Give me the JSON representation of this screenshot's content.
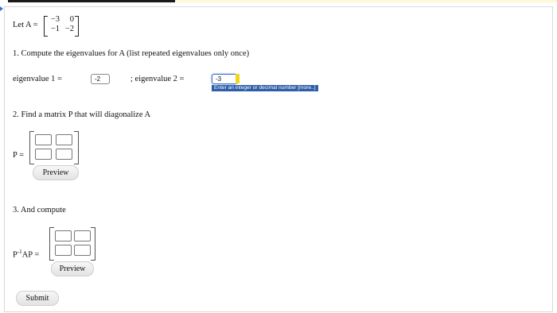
{
  "intro": {
    "let_label": "Let A =",
    "matrix": [
      [
        "−3",
        "0"
      ],
      [
        "−1",
        "−2"
      ]
    ]
  },
  "q1": {
    "prompt": "1. Compute the eigenvalues for A (list repeated eigenvalues only once)",
    "eig1_label": "eigenvalue 1 =",
    "eig1_value": "-2",
    "eig2_label": "; eigenvalue 2 =",
    "eig2_value": "-3",
    "hint": "Enter an integer or decimal number [more..]"
  },
  "q2": {
    "prompt": "2. Find a matrix P that will diagonalize A",
    "matrix_label": "P =",
    "preview_label": "Preview"
  },
  "q3": {
    "prompt": "3. And compute",
    "matrix_label_prefix": "P",
    "matrix_label_sup": "-1",
    "matrix_label_suffix": "AP =",
    "preview_label": "Preview"
  },
  "submit_label": "Submit",
  "colors": {
    "focus_border": "#3d6fd1",
    "hint_bg": "#2e5ea8",
    "cursor_highlight": "#f4d51a"
  }
}
